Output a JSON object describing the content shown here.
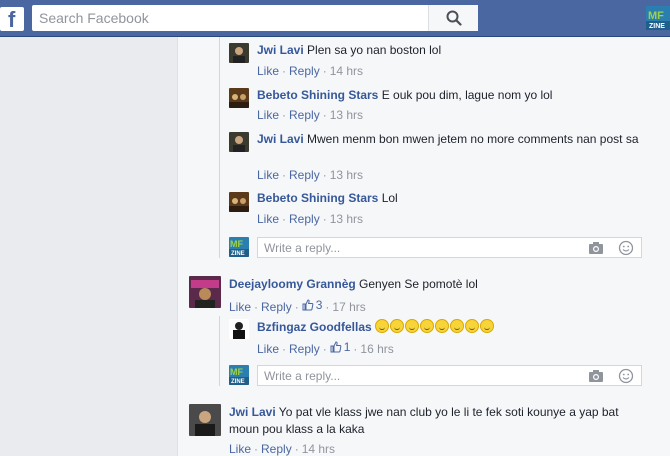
{
  "header": {
    "logo_letter": "f",
    "search_placeholder": "Search Facebook",
    "user_avatar": "mf-avatar-icon"
  },
  "comments": [
    {
      "author": "Jwi Lavi",
      "text": " Plen sa yo nan boston lol",
      "like": "Like",
      "reply": "Reply",
      "time": "14 hrs"
    },
    {
      "author": "Bebeto Shining Stars",
      "text": " E ouk pou dim, lague nom yo lol",
      "like": "Like",
      "reply": "Reply",
      "time": "13 hrs"
    },
    {
      "author": "Jwi Lavi",
      "text": " Mwen menm bon mwen jetem no more comments nan post sa",
      "like": "Like",
      "reply": "Reply",
      "time": "13 hrs"
    },
    {
      "author": "Bebeto Shining Stars",
      "text": " Lol",
      "like": "Like",
      "reply": "Reply",
      "time": "13 hrs"
    },
    {
      "author": "Deejayloomy Grannèg",
      "text": " Genyen Se pomotè lol",
      "like": "Like",
      "reply": "Reply",
      "likes": "3",
      "time": "17 hrs"
    },
    {
      "author": "Bzfingaz Goodfellas",
      "emoji_count": 8,
      "like": "Like",
      "reply": "Reply",
      "likes": "1",
      "time": "16 hrs"
    },
    {
      "author": "Jwi Lavi",
      "text": " Yo pat vle klass jwe nan club yo le li te fek soti kounye a yap bat moun pou klass a la kaka",
      "like": "Like",
      "reply": "Reply",
      "time": "14 hrs"
    }
  ],
  "reply_box": {
    "placeholder": "Write a reply..."
  },
  "colors": {
    "brand": "#4b67a1",
    "author": "#365899",
    "meta": "#90949c"
  }
}
